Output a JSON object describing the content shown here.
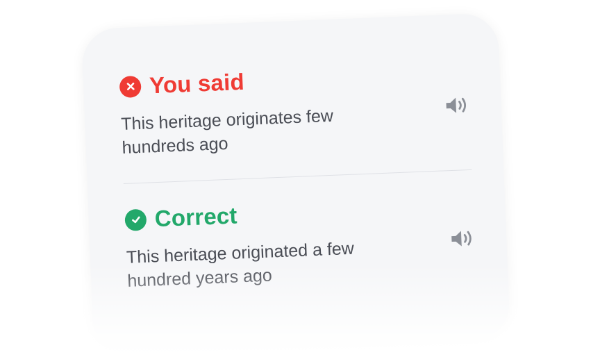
{
  "card": {
    "said": {
      "heading": "You said",
      "status_icon": "close-icon",
      "text": "This heritage originates few hundreds ago",
      "audio_icon": "speaker-icon",
      "color": "#ef3b34"
    },
    "correct": {
      "heading": "Correct",
      "status_icon": "check-icon",
      "text": "This heritage originated a few hundred years ago",
      "audio_icon": "speaker-icon",
      "color": "#22a86a"
    }
  }
}
